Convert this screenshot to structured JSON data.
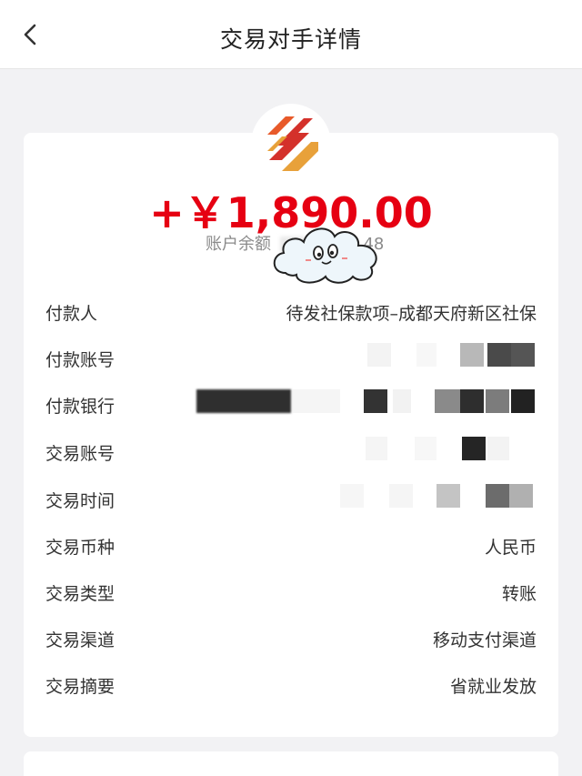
{
  "header": {
    "title": "交易对手详情",
    "back_icon": "chevron-left-icon"
  },
  "summary": {
    "amount": "+￥1,890.00",
    "balance_label": "账户余额",
    "balance_value_partial": "48",
    "amount_color": "#e60012"
  },
  "details": [
    {
      "label": "付款人",
      "value": "待发社保款项–成都天府新区社保"
    },
    {
      "label": "付款账号",
      "value": ""
    },
    {
      "label": "付款银行",
      "value": ""
    },
    {
      "label": "交易账号",
      "value": ""
    },
    {
      "label": "交易时间",
      "value": ""
    },
    {
      "label": "交易币种",
      "value": "人民币"
    },
    {
      "label": "交易类型",
      "value": "转账"
    },
    {
      "label": "交易渠道",
      "value": "移动支付渠道"
    },
    {
      "label": "交易摘要",
      "value": "省就业发放"
    }
  ]
}
